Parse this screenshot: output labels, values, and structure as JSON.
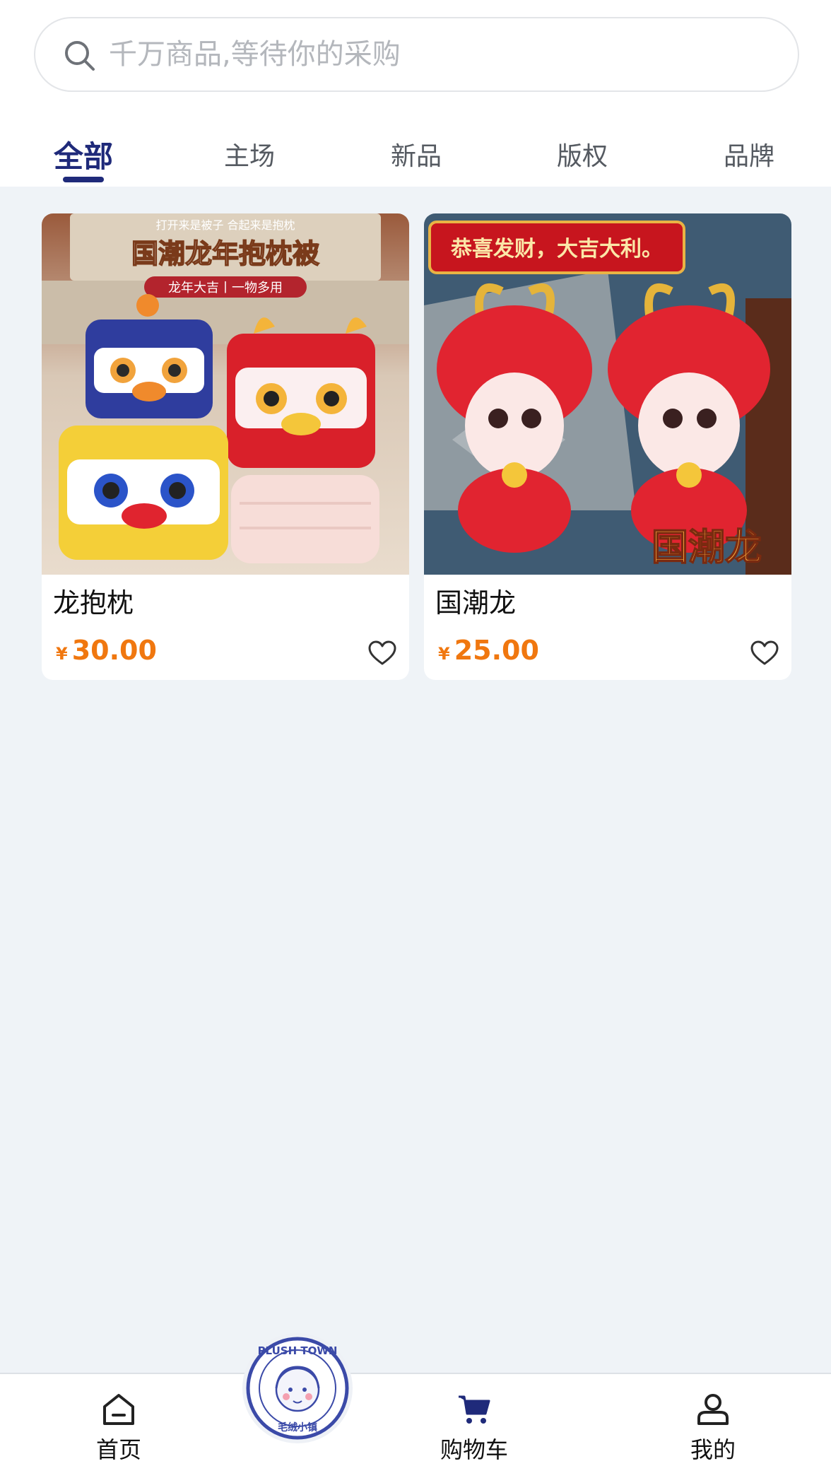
{
  "search": {
    "placeholder": "千万商品,等待你的采购"
  },
  "tabs": [
    {
      "label": "全部",
      "active": true
    },
    {
      "label": "主场",
      "active": false
    },
    {
      "label": "新品",
      "active": false
    },
    {
      "label": "版权",
      "active": false
    },
    {
      "label": "品牌",
      "active": false
    }
  ],
  "products": [
    {
      "title": "龙抱枕",
      "currency": "¥",
      "price": "30.00",
      "image_text": {
        "top": "打开来是被子 合起来是抱枕",
        "main": "国潮龙年抱枕被",
        "badge": "龙年大吉丨一物多用"
      }
    },
    {
      "title": "国潮龙",
      "currency": "¥",
      "price": "25.00",
      "image_text": {
        "banner": "恭喜发财，大吉大利。",
        "main": "国潮龙"
      }
    }
  ],
  "logo": {
    "top": "PLUSH TOWN",
    "bottom": "毛绒小镇"
  },
  "bottom_nav": [
    {
      "label": "首页",
      "icon": "home-icon"
    },
    {
      "label": "购物车",
      "icon": "cart-icon"
    },
    {
      "label": "我的",
      "icon": "user-icon"
    }
  ],
  "colors": {
    "accent": "#1f2a7a",
    "price": "#f0770f",
    "background": "#eff3f7"
  }
}
